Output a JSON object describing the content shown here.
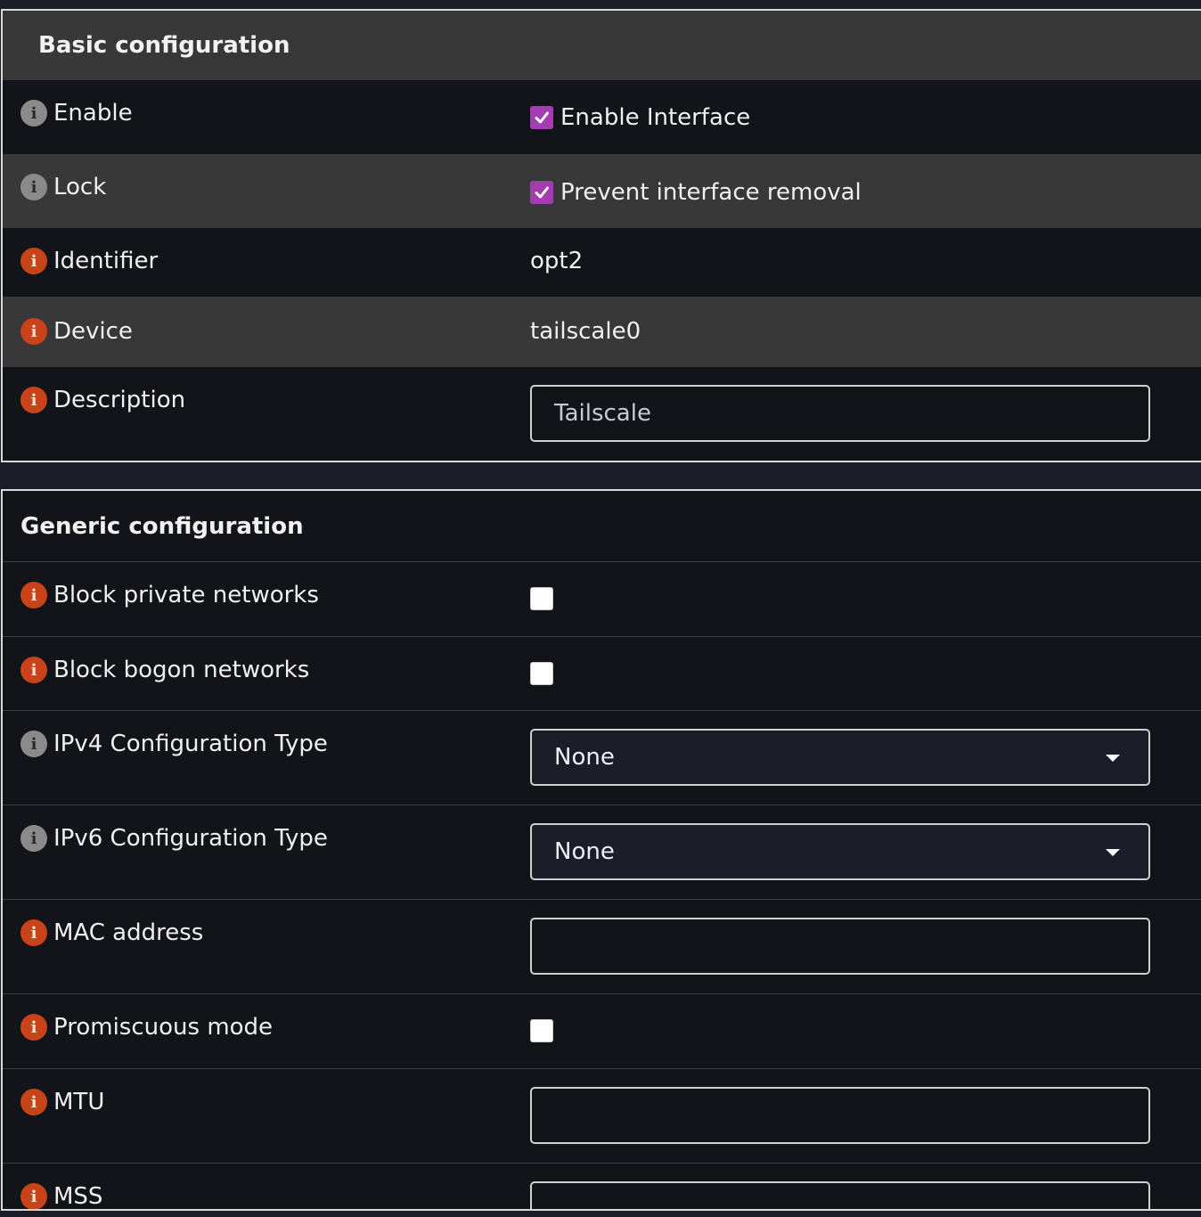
{
  "basic": {
    "title": "Basic configuration",
    "enable": {
      "label": "Enable",
      "checkbox_label": "Enable Interface",
      "checked": true
    },
    "lock": {
      "label": "Lock",
      "checkbox_label": "Prevent interface removal",
      "checked": true
    },
    "identifier": {
      "label": "Identifier",
      "value": "opt2"
    },
    "device": {
      "label": "Device",
      "value": "tailscale0"
    },
    "description": {
      "label": "Description",
      "value": "Tailscale"
    }
  },
  "generic": {
    "title": "Generic configuration",
    "block_private": {
      "label": "Block private networks",
      "checked": false
    },
    "block_bogon": {
      "label": "Block bogon networks",
      "checked": false
    },
    "ipv4_type": {
      "label": "IPv4 Configuration Type",
      "selected": "None"
    },
    "ipv6_type": {
      "label": "IPv6 Configuration Type",
      "selected": "None"
    },
    "mac_address": {
      "label": "MAC address",
      "value": ""
    },
    "promiscuous": {
      "label": "Promiscuous mode",
      "checked": false
    },
    "mtu": {
      "label": "MTU",
      "value": ""
    },
    "mss": {
      "label": "MSS",
      "value": ""
    }
  },
  "colors": {
    "accent_checkbox": "#a43db0",
    "info_required": "#c9431a",
    "info_optional": "#8a8a8a",
    "panel_header": "#383838",
    "background": "#12141a"
  },
  "icons": {
    "info": "info-icon",
    "check": "check-icon",
    "dropdown": "caret-down-icon"
  }
}
